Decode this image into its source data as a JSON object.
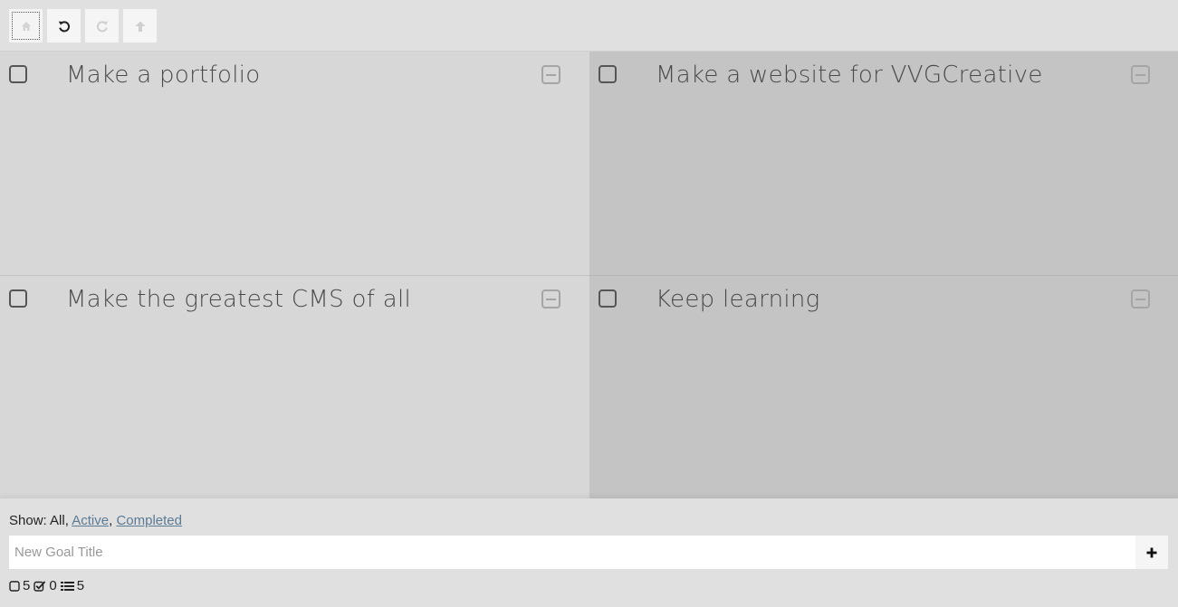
{
  "toolbar": {
    "buttons": [
      {
        "name": "home-button",
        "icon": "home-icon",
        "enabled": false
      },
      {
        "name": "undo-button",
        "icon": "undo-icon",
        "enabled": true
      },
      {
        "name": "redo-button",
        "icon": "redo-icon",
        "enabled": false
      },
      {
        "name": "up-button",
        "icon": "arrow-up-icon",
        "enabled": false
      }
    ]
  },
  "goals": [
    {
      "title": "Make a portfolio",
      "completed": false
    },
    {
      "title": "Make a website for VVGCreative",
      "completed": false
    },
    {
      "title": "Make the greatest CMS of all",
      "completed": false
    },
    {
      "title": "Keep learning",
      "completed": false
    }
  ],
  "footer": {
    "filter_prefix": "Show:",
    "filter_all": "All,",
    "filter_active": "Active",
    "filter_separator": ",",
    "filter_completed": "Completed",
    "new_goal_placeholder": "New Goal Title",
    "add_icon": "plus-icon",
    "stats": {
      "open_count": "5",
      "done_count": "0",
      "total_count": "5"
    }
  },
  "colors": {
    "toolbar_bg": "#e0e0e0",
    "tile_light": "#d7d7d7",
    "tile_dark": "#c4c4c4",
    "link": "#5b7a94",
    "text": "#4a4a4a"
  }
}
